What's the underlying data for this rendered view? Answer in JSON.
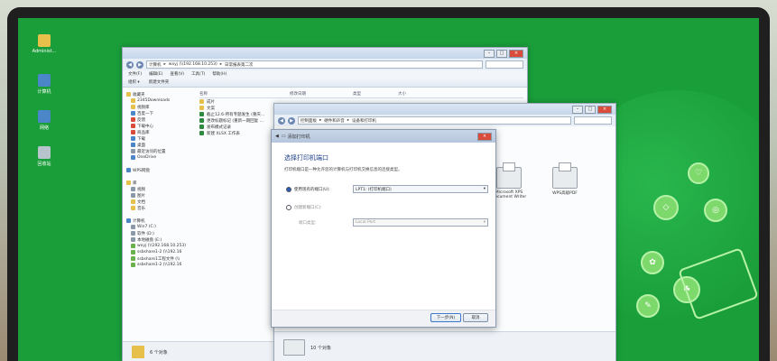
{
  "desktop_icons": [
    {
      "label": "Administ...",
      "icon": "folder-icon",
      "color": "#e6c04a"
    },
    {
      "label": "计算机",
      "icon": "computer-icon",
      "color": "#4a86c8"
    },
    {
      "label": "网络",
      "icon": "network-icon",
      "color": "#4a86c8"
    },
    {
      "label": "回收站",
      "icon": "recycle-bin-icon",
      "color": "#b8c4cc"
    }
  ],
  "explorer": {
    "address_path": [
      "计算机",
      "wxyj (\\\\192.168.10.253)",
      "日常报表第二次"
    ],
    "menu": [
      "文件(F)",
      "编辑(E)",
      "查看(V)",
      "工具(T)",
      "帮助(H)"
    ],
    "toolbar": [
      "组织 ▾",
      "新建文件夹"
    ],
    "nav_items": [
      {
        "label": "收藏夹",
        "color": "#e6c04a"
      },
      {
        "label": "2345Downloads",
        "color": "#e6c04a"
      },
      {
        "label": "视频库",
        "color": "#e6c04a"
      },
      {
        "label": "百度一下",
        "color": "#4a86c8"
      },
      {
        "label": "反馈",
        "color": "#d94b3a"
      },
      {
        "label": "下载中心",
        "color": "#d94b3a"
      },
      {
        "label": "商品库",
        "color": "#d94b3a"
      },
      {
        "label": "下载",
        "color": "#4a86c8"
      },
      {
        "label": "桌面",
        "color": "#4a86c8"
      },
      {
        "label": "最近访问的位置",
        "color": "#8a98a8"
      },
      {
        "label": "OneDrive",
        "color": "#4a86c8"
      },
      {
        "label": "",
        "color": "transparent"
      },
      {
        "label": "WPS网盘",
        "color": "#4a86c8"
      },
      {
        "label": "",
        "color": "transparent"
      },
      {
        "label": "库",
        "color": "#e6c04a"
      },
      {
        "label": "视频",
        "color": "#8a98a8"
      },
      {
        "label": "图片",
        "color": "#8a98a8"
      },
      {
        "label": "文档",
        "color": "#e6c04a"
      },
      {
        "label": "音乐",
        "color": "#e6c04a"
      },
      {
        "label": "",
        "color": "transparent"
      },
      {
        "label": "计算机",
        "color": "#4a86c8"
      },
      {
        "label": "Win7 (C:)",
        "color": "#8a98a8"
      },
      {
        "label": "软件 (D:)",
        "color": "#8a98a8"
      },
      {
        "label": "本地磁盘 (E:)",
        "color": "#8a98a8"
      },
      {
        "label": "wxyj (\\\\192.168.10.253)",
        "color": "#6ab04c"
      },
      {
        "label": "ssbshare1-2 (\\\\192.16",
        "color": "#6ab04c"
      },
      {
        "label": "ssbshare1工程文件 (\\\\",
        "color": "#6ab04c"
      },
      {
        "label": "ssbshare1-2 (\\\\192.16",
        "color": "#6ab04c"
      }
    ],
    "columns": [
      "名称",
      "修改日期",
      "类型",
      "大小"
    ],
    "files": [
      {
        "name": "成片",
        "color": "#e6c04a"
      },
      {
        "name": "文案",
        "color": "#e6c04a"
      },
      {
        "name": "截止12.6-所有专题发生 (重庆...",
        "color": "#2d8a3e"
      },
      {
        "name": "更改标题标记 (重新一期回复 ...",
        "color": "#2d8a3e"
      },
      {
        "name": "发布模式记录",
        "color": "#2d8a3e"
      },
      {
        "name": "新建 XLSX 工作表",
        "color": "#2d8a3e"
      }
    ],
    "status": "6 个对象"
  },
  "devices_window": {
    "address_path": [
      "控制面板",
      "硬件和声音",
      "设备和打印机"
    ],
    "printers": [
      {
        "label": "Microsoft XPS Document Writer"
      },
      {
        "label": "WPS高级PDF"
      }
    ],
    "status": "10 个对象"
  },
  "dialog": {
    "title": "添加打印机",
    "heading": "选择打印机端口",
    "description": "打印机端口是一种允许您的计算机与打印机交换信息的连接类型。",
    "option_existing": "使用现有的端口(U):",
    "existing_value": "LPT1: (打印机端口)",
    "option_new": "创建新端口(C):",
    "port_type_label": "端口类型:",
    "port_type_value": "Local Port",
    "next": "下一步(N)",
    "cancel": "取消"
  }
}
